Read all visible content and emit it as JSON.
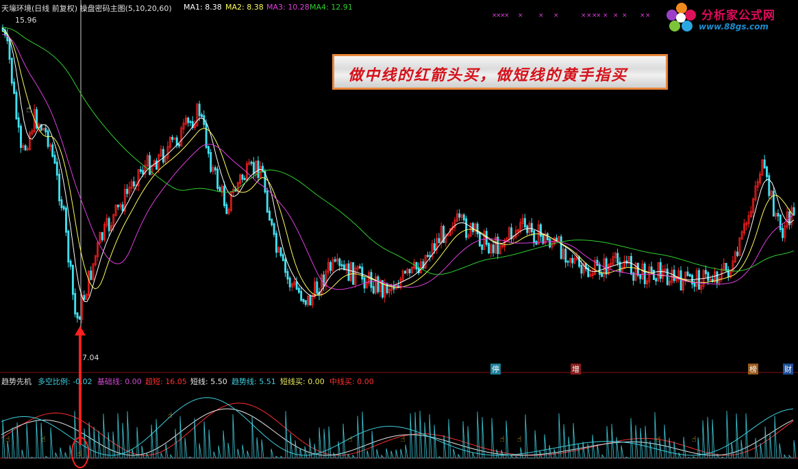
{
  "header": {
    "title": "天壕环境(日线 前复权) 操盘密码主图(5,10,20,60)",
    "ma1": "MA1: 8.38",
    "ma2": "MA2: 8.38",
    "ma3": "MA3: 10.28",
    "ma4": "MA4: 12.91"
  },
  "logo": {
    "name": "分析家公式网",
    "url": "www.88gs.com"
  },
  "banner": {
    "text": "做中线的红箭头买，做短线的黄手指买"
  },
  "main_chart": {
    "high_label": "15.96",
    "low_label": "7.04",
    "event_markers": [
      "停",
      "增",
      "榜",
      "财"
    ]
  },
  "sub_indicator": {
    "name": "趋势先机",
    "items": [
      {
        "label": "多空比例: -0.02",
        "color": "#3fd0e0"
      },
      {
        "label": "基础线: 0.00",
        "color": "#d04ad0"
      },
      {
        "label": "超短: 16.05",
        "color": "#ff3030"
      },
      {
        "label": "短线: 5.50",
        "color": "#e8e8e8"
      },
      {
        "label": "趋势线: 5.51",
        "color": "#3fd0e0"
      },
      {
        "label": "短线买: 0.00",
        "color": "#e8e860"
      },
      {
        "label": "中线买: 0.00",
        "color": "#ff3030"
      }
    ]
  },
  "colors": {
    "up": "#ff2020",
    "down": "#40e0f0",
    "ma1": "#ffffff",
    "ma2": "#ffff60",
    "ma3": "#e040e0",
    "ma4": "#30d030"
  }
}
